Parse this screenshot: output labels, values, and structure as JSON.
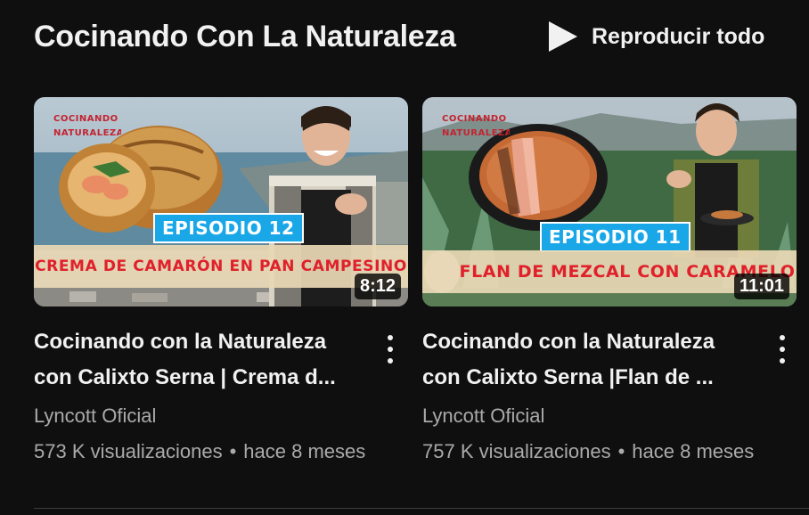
{
  "shelf": {
    "title": "Cocinando Con La Naturaleza",
    "play_all_label": "Reproducir todo",
    "play_icon": "play-icon"
  },
  "videos": [
    {
      "thumbnail": {
        "brand_line1": "COCINANDO",
        "brand_line2": "NATURALEZA",
        "episode": "EPISODIO 12",
        "banner": "CREMA DE CAMARÓN EN PAN CAMPESINO",
        "duration": "8:12"
      },
      "title_line1": "Cocinando con la Naturaleza",
      "title_line2": "con Calixto Serna | Crema d...",
      "channel": "Lyncott Oficial",
      "views": "573 K visualizaciones",
      "separator": "•",
      "age": "hace 8 meses",
      "menu_icon": "more-vert-icon"
    },
    {
      "thumbnail": {
        "brand_line1": "COCINANDO",
        "brand_line2": "NATURALEZA",
        "episode": "EPISODIO 11",
        "banner": "FLAN DE MEZCAL CON CARAMELO",
        "duration": "11:01"
      },
      "title_line1": "Cocinando con la Naturaleza",
      "title_line2": "con Calixto Serna |Flan de ...",
      "channel": "Lyncott Oficial",
      "views": "757 K visualizaciones",
      "separator": "•",
      "age": "hace 8 meses",
      "menu_icon": "more-vert-icon"
    }
  ],
  "colors": {
    "background": "#0f0f0f",
    "text_primary": "#f1f1f1",
    "text_secondary": "#aaaaaa",
    "episode_badge": "#1aa7e8",
    "banner_text": "#e0202a"
  }
}
